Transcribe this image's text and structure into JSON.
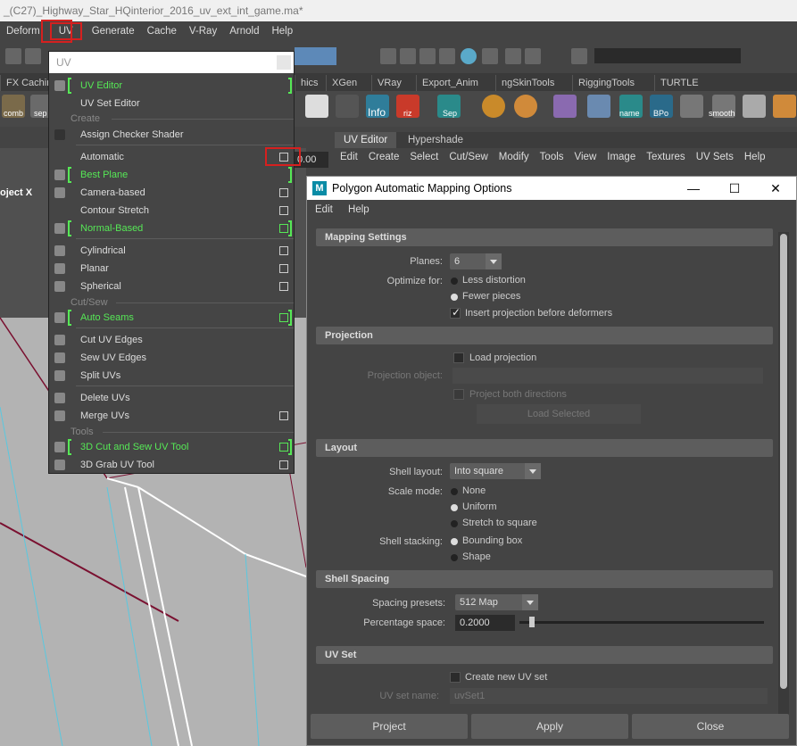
{
  "window_title": "_(C27)_Highway_Star_HQinterior_2016_uv_ext_int_game.ma*",
  "main_menu": [
    "Deform",
    "UV",
    "Generate",
    "Cache",
    "V-Ray",
    "Arnold",
    "Help"
  ],
  "shelf_tabs": [
    "FX Caching",
    "hics",
    "XGen",
    "VRay",
    "Export_Anim",
    "ngSkinTools",
    "RiggingTools",
    "TURTLE"
  ],
  "shelf_labels": [
    "comb",
    "sep",
    "Info",
    "riz",
    "Sep",
    "name",
    "BPo",
    "smooth"
  ],
  "viewport_label": "oject X",
  "uv_editor_tabs": [
    "UV Editor",
    "Hypershade"
  ],
  "uv_editor_menu": [
    "Edit",
    "Create",
    "Select",
    "Cut/Sew",
    "Modify",
    "Tools",
    "View",
    "Image",
    "Textures",
    "UV Sets",
    "Help"
  ],
  "num_field": "0.00",
  "uv_menu": {
    "title": "UV",
    "items": {
      "uv_editor": "UV Editor",
      "uv_set_editor": "UV Set Editor",
      "sec_create": "Create",
      "assign_checker": "Assign Checker Shader",
      "automatic": "Automatic",
      "best_plane": "Best Plane",
      "camera_based": "Camera-based",
      "contour_stretch": "Contour Stretch",
      "normal_based": "Normal-Based",
      "cylindrical": "Cylindrical",
      "planar": "Planar",
      "spherical": "Spherical",
      "sec_cutsew": "Cut/Sew",
      "auto_seams": "Auto Seams",
      "cut_uv_edges": "Cut UV Edges",
      "sew_uv_edges": "Sew UV Edges",
      "split_uvs": "Split UVs",
      "delete_uvs": "Delete UVs",
      "merge_uvs": "Merge UVs",
      "sec_tools": "Tools",
      "cut_sew_tool": "3D Cut and Sew UV Tool",
      "grab_uv_tool": "3D Grab UV Tool"
    }
  },
  "dialog": {
    "title": "Polygon Automatic Mapping Options",
    "menu": [
      "Edit",
      "Help"
    ],
    "mapping_settings": {
      "header": "Mapping Settings",
      "planes_label": "Planes:",
      "planes_value": "6",
      "optimize_label": "Optimize for:",
      "opt_less": "Less distortion",
      "opt_fewer": "Fewer pieces",
      "insert_projection": "Insert projection before deformers"
    },
    "projection": {
      "header": "Projection",
      "load_projection": "Load projection",
      "projection_object_label": "Projection object:",
      "project_both": "Project both directions",
      "load_selected": "Load Selected"
    },
    "layout": {
      "header": "Layout",
      "shell_layout_label": "Shell layout:",
      "shell_layout_value": "Into square",
      "scale_mode_label": "Scale mode:",
      "scale_none": "None",
      "scale_uniform": "Uniform",
      "scale_stretch": "Stretch to square",
      "shell_stacking_label": "Shell stacking:",
      "stack_bbox": "Bounding box",
      "stack_shape": "Shape"
    },
    "shell_spacing": {
      "header": "Shell Spacing",
      "presets_label": "Spacing presets:",
      "presets_value": "512 Map",
      "percentage_label": "Percentage space:",
      "percentage_value": "0.2000",
      "slider_fraction": 0.05
    },
    "uv_set": {
      "header": "UV Set",
      "create_new": "Create new UV set",
      "set_name_label": "UV set name:",
      "set_name_value": "uvSet1"
    },
    "buttons": {
      "project": "Project",
      "apply": "Apply",
      "close": "Close"
    }
  }
}
